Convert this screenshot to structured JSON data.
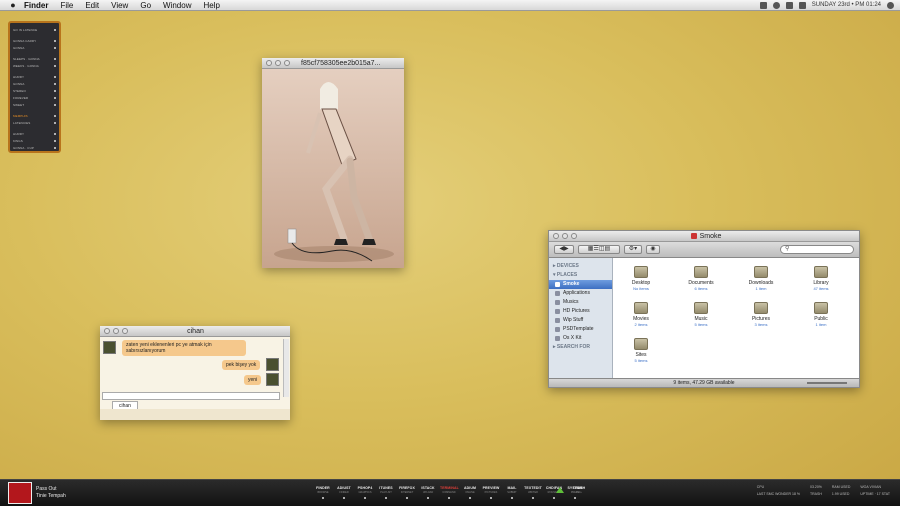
{
  "menubar": {
    "apple": "",
    "items": [
      "Finder",
      "File",
      "Edit",
      "View",
      "Go",
      "Window",
      "Help"
    ],
    "clock": "SUNDAY 23rd  •  PM 01:24"
  },
  "widget": {
    "rows": [
      {
        "label": "GO IN LATENCE",
        "hl": false,
        "gap": false
      },
      {
        "label": "GONNA CARRY",
        "hl": false,
        "gap": true
      },
      {
        "label": "GONNA",
        "hl": false,
        "gap": false
      },
      {
        "label": "SLEEPS · GONNA",
        "hl": false,
        "gap": true
      },
      {
        "label": "WEEKS · GONNA",
        "hl": false,
        "gap": false
      },
      {
        "label": "HURRY",
        "hl": false,
        "gap": true
      },
      {
        "label": "GONNA",
        "hl": false,
        "gap": false
      },
      {
        "label": "STEREO",
        "hl": false,
        "gap": false
      },
      {
        "label": "FOREVER",
        "hl": false,
        "gap": false
      },
      {
        "label": "SWEET",
        "hl": false,
        "gap": false
      },
      {
        "label": "MEMPHIS",
        "hl": true,
        "gap": true
      },
      {
        "label": "LATENCIES",
        "hl": false,
        "gap": false
      },
      {
        "label": "HURRY",
        "hl": false,
        "gap": true
      },
      {
        "label": "KINGS",
        "hl": false,
        "gap": false
      },
      {
        "label": "GONNA · CUP",
        "hl": false,
        "gap": false
      }
    ]
  },
  "viewer": {
    "title": "f85cf758305ee2b015a7..."
  },
  "chat": {
    "title": "cihan",
    "messages": [
      {
        "text": "zaten yeni eklenenleri pc ye atmak için sabırsızlanıyorum",
        "dir": "in"
      },
      {
        "text": "pek bişey yok",
        "dir": "out"
      },
      {
        "text": "yeni",
        "dir": "out"
      }
    ],
    "tab": "cihan"
  },
  "finder": {
    "title": "Smoke",
    "search_placeholder": "",
    "sidebar": {
      "devices_header": "DEVICES",
      "places_header": "PLACES",
      "search_header": "SEARCH FOR",
      "places": [
        {
          "label": "Smoke",
          "active": true
        },
        {
          "label": "Applications",
          "active": false
        },
        {
          "label": "Musics",
          "active": false
        },
        {
          "label": "HD Pictures",
          "active": false
        },
        {
          "label": "Wip Stuff",
          "active": false
        },
        {
          "label": "PSDTemplate",
          "active": false
        },
        {
          "label": "Os X Kit",
          "active": false
        }
      ]
    },
    "items": [
      {
        "name": "Desktop",
        "count": "No items"
      },
      {
        "name": "Documents",
        "count": "6 items"
      },
      {
        "name": "Downloads",
        "count": "1 item"
      },
      {
        "name": "Library",
        "count": "47 items"
      },
      {
        "name": "Movies",
        "count": "2 items"
      },
      {
        "name": "Music",
        "count": "5 items"
      },
      {
        "name": "Pictures",
        "count": "3 items"
      },
      {
        "name": "Public",
        "count": "1 item"
      },
      {
        "name": "Sites",
        "count": "5 items"
      }
    ],
    "status": "9 items, 47.29 GB available"
  },
  "dock": {
    "now_playing": {
      "track": "Pass Out",
      "artist": "Tinie Tempah"
    },
    "apps": [
      {
        "label": "FINDER",
        "sub": "BROWSE",
        "active": false
      },
      {
        "label": "ADIUST",
        "sub": "FINDER",
        "active": false
      },
      {
        "label": "PSHOP4",
        "sub": "GRAPHICS",
        "active": false
      },
      {
        "label": "ITUNES",
        "sub": "PLAYLIST",
        "active": false
      },
      {
        "label": "FIREFOX",
        "sub": "INTERNET",
        "active": false
      },
      {
        "label": "ISTACK",
        "sub": "UPLOAD",
        "active": false
      },
      {
        "label": "TERMINAL",
        "sub": "COMMAND",
        "active": true
      },
      {
        "label": "ADIUM",
        "sub": "ONLINE",
        "active": false
      },
      {
        "label": "PREVIEW",
        "sub": "PICTURES",
        "active": false
      },
      {
        "label": "MAIL",
        "sub": "SUBMIT",
        "active": false
      },
      {
        "label": "TEXTEDIT",
        "sub": "WRITER",
        "active": false
      },
      {
        "label": "CHDIFAN",
        "sub": "ROUNDER",
        "active": false
      },
      {
        "label": "SYSTEM",
        "sub": "PREFS",
        "active": false
      }
    ],
    "trash": {
      "label": "TRASH",
      "sub": "FULL"
    },
    "stats": [
      "CPU",
      "03.20%",
      "RAM USED",
      "WOA VIVIAN",
      "LAST SMC WONDER 18 %",
      "TRASH",
      "1.99 USED",
      "UPTIME · 17 STAT"
    ]
  }
}
